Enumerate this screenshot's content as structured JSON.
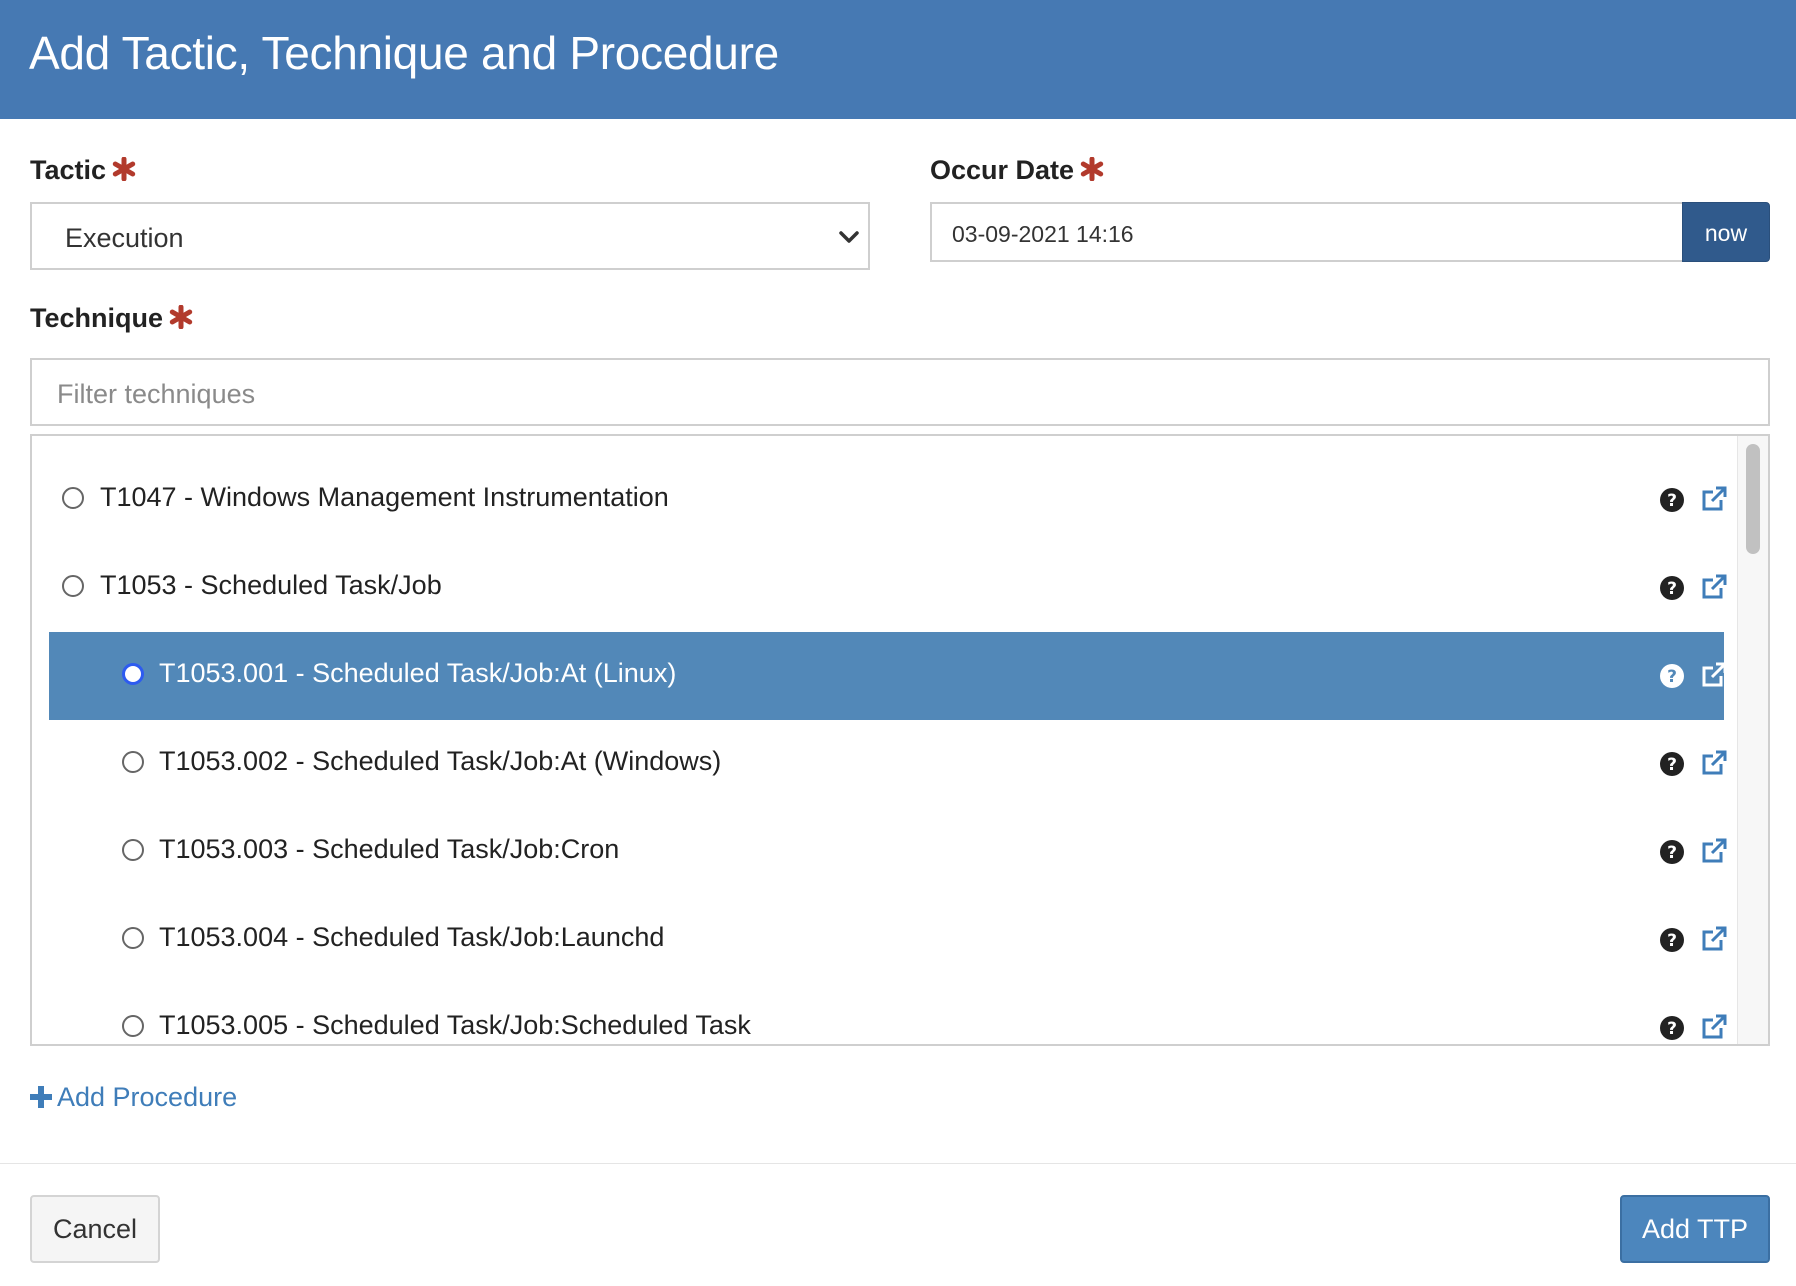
{
  "dialog": {
    "title": "Add Tactic, Technique and Procedure"
  },
  "tactic": {
    "label": "Tactic",
    "value": "Execution"
  },
  "occur_date": {
    "label": "Occur Date",
    "value": "03-09-2021 14:16",
    "now_label": "now"
  },
  "technique": {
    "label": "Technique",
    "filter_placeholder": "Filter techniques",
    "items": [
      {
        "label": "T1047 - Windows Management Instrumentation",
        "selected": false
      },
      {
        "label": "T1053 - Scheduled Task/Job",
        "selected": false
      },
      {
        "label": "T1053.001 - Scheduled Task/Job:At (Linux)",
        "selected": true
      },
      {
        "label": "T1053.002 - Scheduled Task/Job:At (Windows)",
        "selected": false
      },
      {
        "label": "T1053.003 - Scheduled Task/Job:Cron",
        "selected": false
      },
      {
        "label": "T1053.004 - Scheduled Task/Job:Launchd",
        "selected": false
      },
      {
        "label": "T1053.005 - Scheduled Task/Job:Scheduled Task",
        "selected": false
      }
    ]
  },
  "add_procedure_label": "Add Procedure",
  "footer": {
    "cancel_label": "Cancel",
    "submit_label": "Add TTP"
  },
  "colors": {
    "header": "#4679b3",
    "selected_row": "#5288b8",
    "required": "#b23a2c",
    "link": "#3f7db9"
  }
}
